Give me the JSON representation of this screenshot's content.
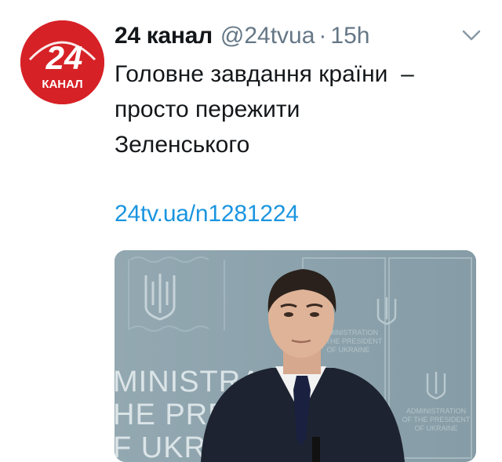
{
  "tweet": {
    "avatar": {
      "number": "24",
      "label": "КАНАЛ",
      "color": "#d62126"
    },
    "author_name": "24 канал",
    "handle": "@24tvua",
    "separator": "·",
    "time": "15h",
    "text": "Головне завдання країни  –\nпросто пережити\nЗеленського",
    "link": "24tv.ua/n1281224",
    "menu_icon": "chevron-down-icon",
    "media": {
      "backdrop_text_left": [
        "MINISTRAT",
        "HE PRES",
        "F UKRA"
      ],
      "backdrop_text_right_top": [
        "ADMINISTRATION",
        "OF THE PRESIDENT",
        "OF UKRAINE"
      ],
      "backdrop_text_right_bottom": [
        "ADMINISTRATION",
        "OF THE PRESIDENT",
        "OF UKRAINE"
      ]
    }
  },
  "colors": {
    "link": "#1b95e0",
    "muted": "#657786",
    "text": "#14171a",
    "backdrop": "#8aa0aa"
  }
}
